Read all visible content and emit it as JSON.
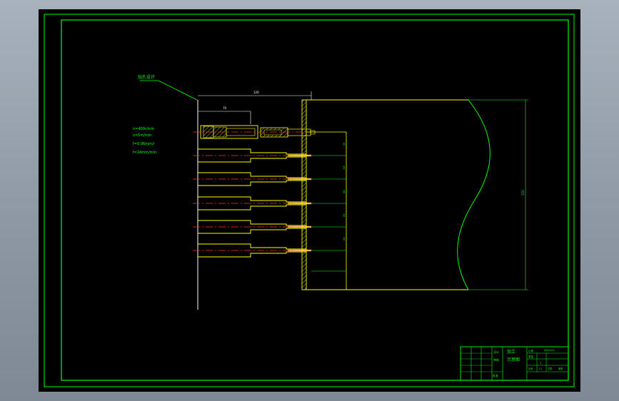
{
  "drawing": {
    "colors": {
      "background": "#000000",
      "frame": "#00ff00",
      "part": "#ffff00",
      "centerline": "#ff0000",
      "annotation": "#00ff00",
      "chrome": "#9aa5b0"
    },
    "leader_note": "钻孔设计",
    "parameters": [
      "n=400r/min",
      "v=5m/min",
      "f=0.06mm/r",
      "f=24mm/min"
    ],
    "dimensions": {
      "overall_width": "120",
      "tool_length": "70",
      "part_height": "120",
      "hole_spacing": "24"
    }
  },
  "title_block": {
    "title_line1": "加工",
    "title_line2": "示意图",
    "label_design": "设计",
    "label_check": "审核",
    "label_approve": "批准",
    "label_scale": "比例",
    "label_sheet": "1",
    "label_weight": "重量",
    "drawing_no": "XXX-001",
    "bottom_cells": [
      "比例",
      "1:1",
      "共张",
      "第张"
    ]
  }
}
